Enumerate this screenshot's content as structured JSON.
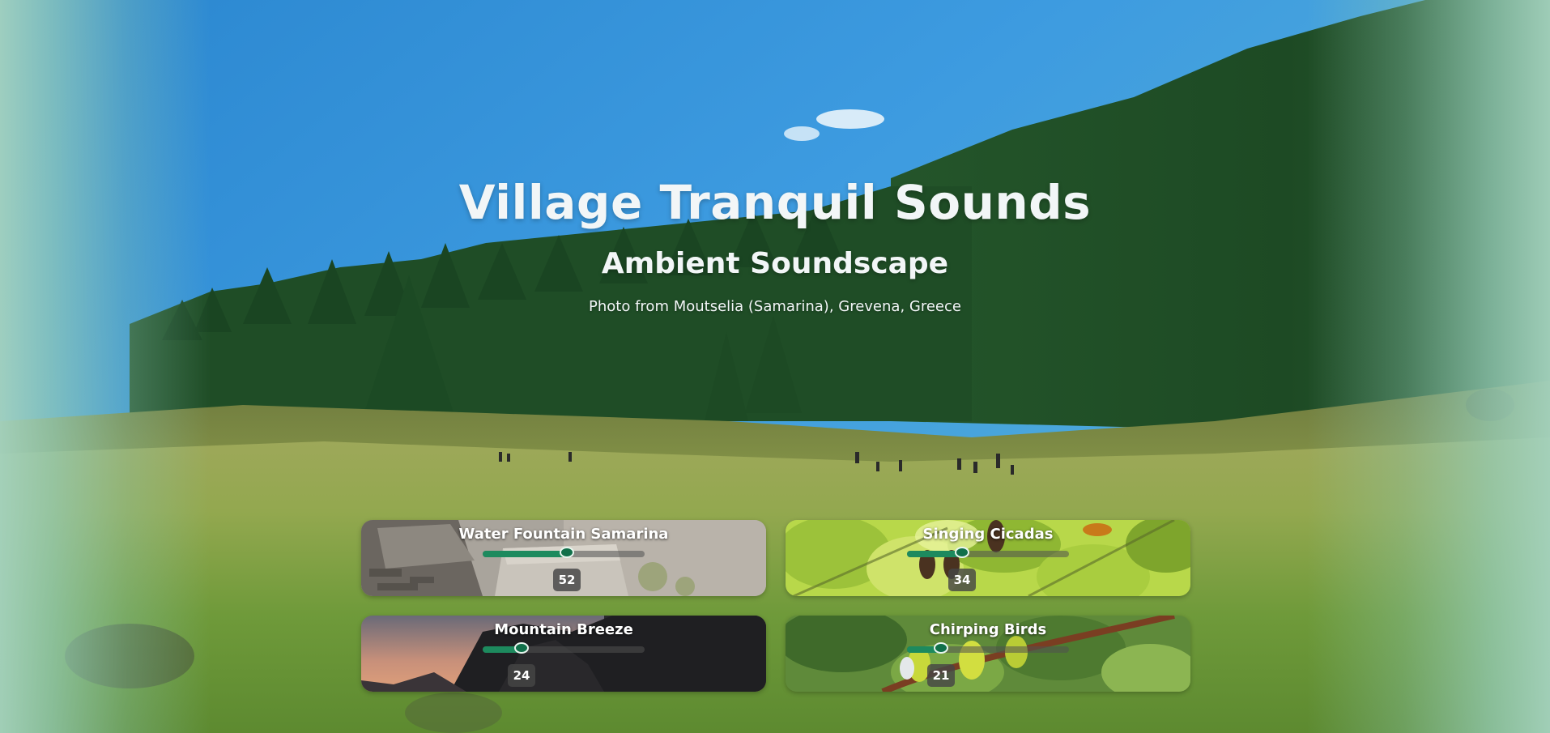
{
  "hero": {
    "title": "Village Tranquil Sounds",
    "subtitle": "Ambient Soundscape",
    "credit": "Photo from Moutselia (Samarina), Grevena, Greece"
  },
  "theme": {
    "accent": "#1d8a5e",
    "thumb": "#11704a",
    "badge_bg": "#464646",
    "sky_top": "#2f8fd8",
    "meadow": "#7fa34a",
    "forest": "#1f4a26",
    "side_fade": "#a4d2be"
  },
  "sounds": [
    {
      "name": "Water Fountain Samarina",
      "volume": 52,
      "art": "stone-fountain"
    },
    {
      "name": "Singing Cicadas",
      "volume": 34,
      "art": "cicadas-on-leaves"
    },
    {
      "name": "Mountain Breeze",
      "volume": 24,
      "art": "mountain-dusk"
    },
    {
      "name": "Chirping Birds",
      "volume": 21,
      "art": "birds-on-branch"
    }
  ]
}
